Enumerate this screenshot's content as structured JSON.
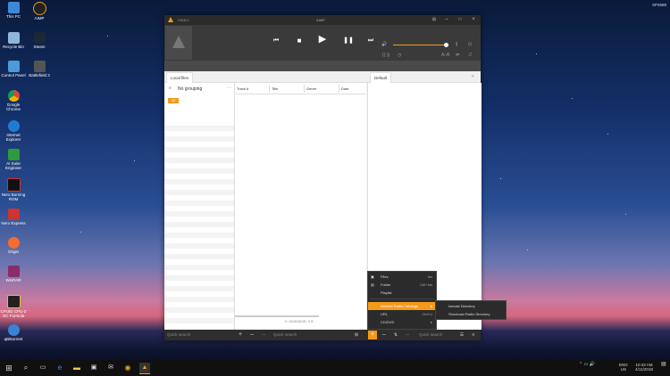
{
  "desktop": {
    "corner_text": "SP4588",
    "icons": [
      {
        "label": "This PC"
      },
      {
        "label": "AIMP"
      },
      {
        "label": "Recycle Bin"
      },
      {
        "label": "Steam"
      },
      {
        "label": "Control Panel"
      },
      {
        "label": "Battlefield 3"
      },
      {
        "label": "Google Chrome"
      },
      {
        "label": "Internet Explorer"
      },
      {
        "label": "AI Suite Engineer"
      },
      {
        "label": "Nero Burning ROM"
      },
      {
        "label": "Nero Express"
      },
      {
        "label": "Origin"
      },
      {
        "label": "WinRAR"
      },
      {
        "label": "CPUID CPU-Z OC Formula"
      },
      {
        "label": "qBittorrent"
      }
    ]
  },
  "aimp": {
    "title": "AIMP",
    "appname": "RIBBO",
    "tabs": {
      "local_files": "Local files",
      "default": "Default"
    },
    "grouping": "No grouping",
    "all_badge": "All",
    "columns": [
      "Track #",
      "Title",
      "Genre",
      "Date"
    ],
    "status": "0 / 00:00:00:00 / 0 B",
    "quick_search_left": "Quick search",
    "quick_search_mid": "Quick search",
    "quick_search_right": "Quick search",
    "ab_label": "A–B"
  },
  "add_menu": {
    "items": [
      {
        "label": "Files",
        "shortcut": "Ins"
      },
      {
        "label": "Folder",
        "shortcut": "Ctrl+Ins"
      },
      {
        "label": "Playlist",
        "shortcut": ""
      },
      {
        "label": "Internet Radio Catalogs",
        "shortcut": "▸"
      },
      {
        "label": "URL",
        "shortcut": "Ctrl+U"
      },
      {
        "label": "CD/DVD",
        "shortcut": "▸"
      }
    ]
  },
  "radio_submenu": {
    "items": [
      "Icecast Directory",
      "Shoutcast Radio Directory"
    ]
  },
  "taskbar": {
    "time": "10:43 AM",
    "date": "4/11/2018",
    "lang": "ENG",
    "region": "US"
  },
  "colors": {
    "accent": "#f49a1a"
  }
}
